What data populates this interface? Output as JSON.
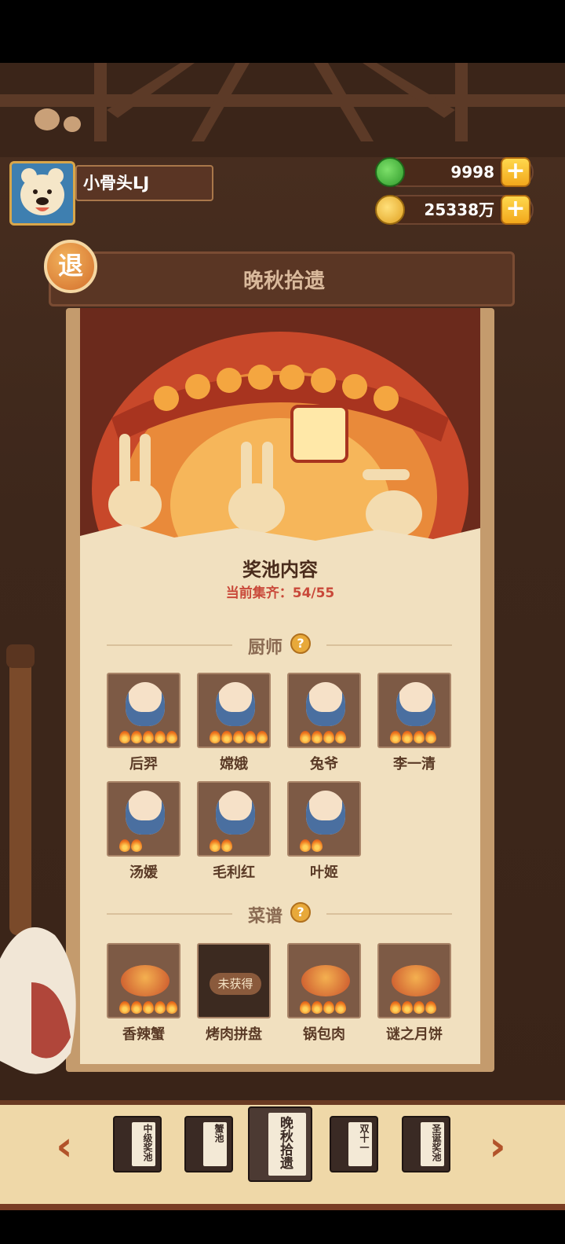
{
  "player": {
    "name": "小骨头LJ",
    "avatar_icon": "bear-avatar-icon"
  },
  "currency": [
    {
      "icon": "jade-icon",
      "value": "9998",
      "plus_label": "+"
    },
    {
      "icon": "coin-icon",
      "value": "25338万",
      "plus_label": "+"
    }
  ],
  "nav": {
    "exit_label": "退",
    "page_title": "晚秋拾遗"
  },
  "pool": {
    "title": "奖池内容",
    "progress": "当前集齐：54/55"
  },
  "sections": {
    "chefs": {
      "label": "厨师",
      "help": "?"
    },
    "recipes": {
      "label": "菜谱",
      "help": "?"
    }
  },
  "chefs": [
    {
      "name": "后羿",
      "stars": 5
    },
    {
      "name": "嫦娥",
      "stars": 5
    },
    {
      "name": "兔爷",
      "stars": 4
    },
    {
      "name": "李一清",
      "stars": 4
    },
    {
      "name": "汤媛",
      "stars": 2
    },
    {
      "name": "毛利红",
      "stars": 2
    },
    {
      "name": "叶姬",
      "stars": 2
    }
  ],
  "recipes": [
    {
      "name": "香辣蟹",
      "stars": 5,
      "locked": false
    },
    {
      "name": "烤肉拼盘",
      "stars": 0,
      "locked": true,
      "lock_label": "未获得"
    },
    {
      "name": "锅包肉",
      "stars": 4,
      "locked": false
    },
    {
      "name": "谜之月饼",
      "stars": 4,
      "locked": false
    }
  ],
  "tabs": {
    "prev_label": "‹",
    "next_label": "›",
    "items": [
      {
        "label": "中级奖池",
        "active": false
      },
      {
        "label": "蟹池",
        "active": false
      },
      {
        "label": "晚秋拾遗",
        "active": true
      },
      {
        "label": "双十一",
        "active": false
      },
      {
        "label": "圣诞奖池",
        "active": false
      }
    ]
  },
  "colors": {
    "accent_red": "#c9493a",
    "gold": "#f2a81c",
    "paper": "#f1e0bf",
    "frame_brown": "#5a3624"
  }
}
